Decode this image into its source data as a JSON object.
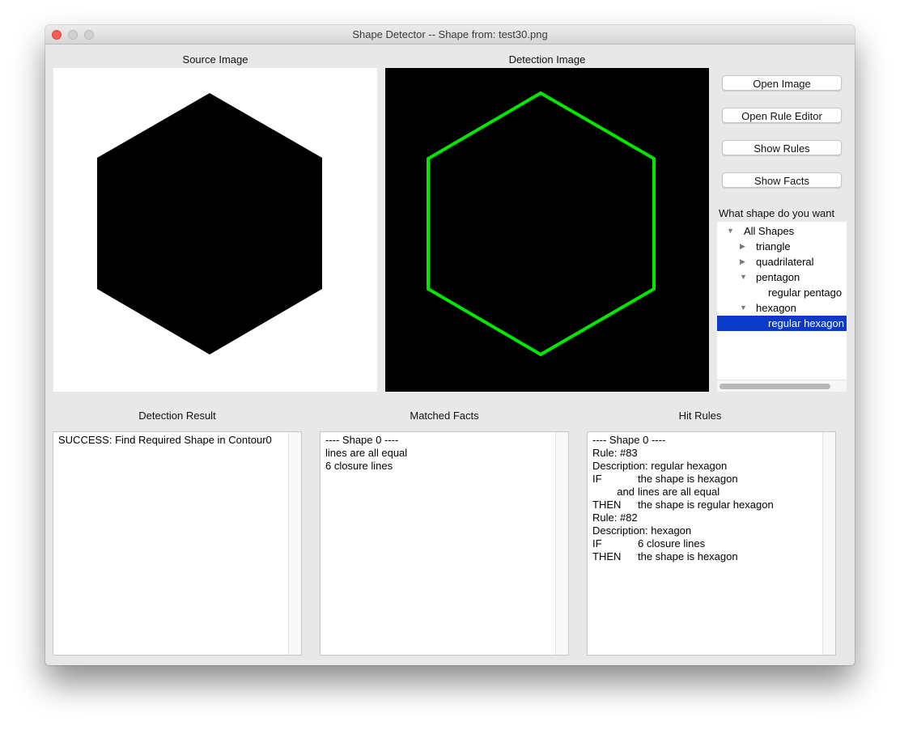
{
  "window": {
    "title": "Shape Detector -- Shape from: test30.png"
  },
  "source_panel": {
    "label": "Source Image",
    "background": "#ffffff",
    "shape_fill": "#000000",
    "shape": "hexagon"
  },
  "detection_panel": {
    "label": "Detection Image",
    "background": "#000000",
    "outline_color": "#00e600",
    "shape": "hexagon"
  },
  "buttons": {
    "open_image": "Open Image",
    "open_rule_editor": "Open Rule Editor",
    "show_rules": "Show Rules",
    "show_facts": "Show Facts"
  },
  "shape_tree": {
    "label": "What shape do you want",
    "selection_color": "#0b3ac8",
    "items": [
      {
        "label": "All Shapes",
        "level": 0,
        "expanded": true,
        "has_children": true
      },
      {
        "label": "triangle",
        "level": 1,
        "expanded": false,
        "has_children": true
      },
      {
        "label": "quadrilateral",
        "level": 1,
        "expanded": false,
        "has_children": true
      },
      {
        "label": "pentagon",
        "level": 1,
        "expanded": true,
        "has_children": true
      },
      {
        "label": "regular pentago",
        "level": 2,
        "expanded": false,
        "has_children": false
      },
      {
        "label": "hexagon",
        "level": 1,
        "expanded": true,
        "has_children": true
      },
      {
        "label": "regular hexagon",
        "level": 2,
        "expanded": false,
        "has_children": false,
        "selected": true
      }
    ]
  },
  "detection_result": {
    "label": "Detection Result",
    "lines": [
      "SUCCESS: Find Required Shape in Contour0"
    ]
  },
  "matched_facts": {
    "label": "Matched Facts",
    "lines": [
      "---- Shape 0 ----",
      "lines are all equal",
      "6 closure lines"
    ]
  },
  "hit_rules": {
    "label": "Hit Rules",
    "lines": [
      {
        "kw": "",
        "text": "---- Shape 0 ----"
      },
      {
        "kw": "",
        "text": "Rule: #83"
      },
      {
        "kw": "",
        "text": "Description: regular hexagon"
      },
      {
        "kw": "IF",
        "text": "the shape is hexagon"
      },
      {
        "kw": "and",
        "text": "lines are all equal",
        "indent": true
      },
      {
        "kw": "THEN",
        "text": "the shape is regular hexagon"
      },
      {
        "kw": "",
        "text": "Rule: #82"
      },
      {
        "kw": "",
        "text": "Description: hexagon"
      },
      {
        "kw": "IF",
        "text": "6 closure lines"
      },
      {
        "kw": "THEN",
        "text": "the shape is hexagon"
      }
    ]
  }
}
